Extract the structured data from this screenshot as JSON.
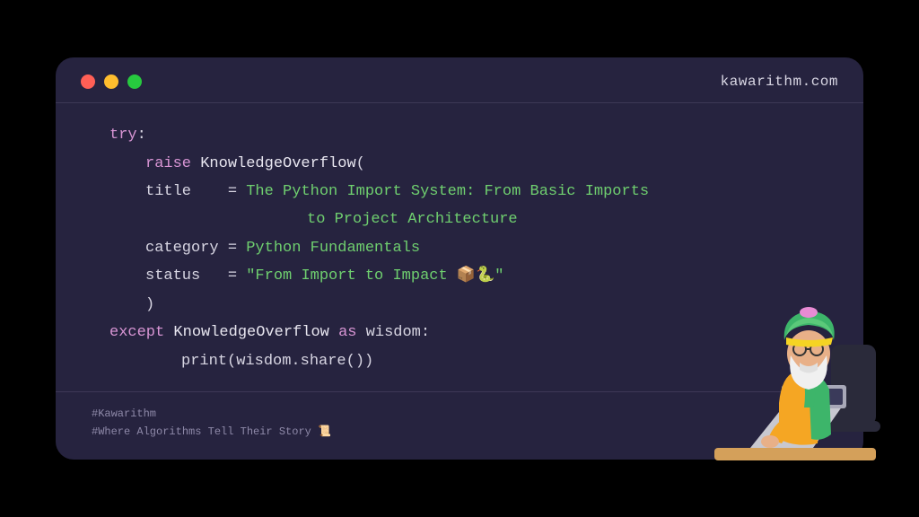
{
  "header": {
    "site": "kawarithm.com"
  },
  "code": {
    "try": "try",
    "colon": ":",
    "raise": "raise",
    "exception_class": "KnowledgeOverflow",
    "open_paren": "(",
    "close_paren": ")",
    "title_key": "title",
    "eq": "=",
    "title_val_l1": "The Python Import System: From Basic Imports",
    "title_val_l2": "to Project Architecture",
    "category_key": "category",
    "category_val": "Python Fundamentals",
    "status_key": "status",
    "status_val": "\"From Import to Impact 📦🐍\"",
    "except": "except",
    "as": "as",
    "alias": "wisdom",
    "print_line": "print(wisdom.share())"
  },
  "footer": {
    "tag1": "#Kawarithm",
    "tag2": "#Where Algorithms Tell Their Story 📜"
  }
}
